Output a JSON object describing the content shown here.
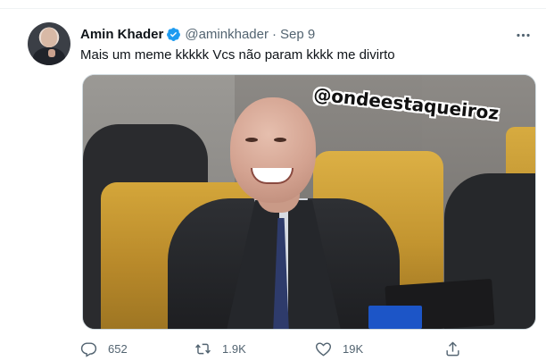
{
  "tweet": {
    "author_name": "Amin Khader",
    "handle": "@aminkhader",
    "separator": "·",
    "date": "Sep 9",
    "text": "Mais um meme kkkkk Vcs não param kkkk me divirto",
    "media": {
      "watermark_text": "@ondeestaqueiroz"
    },
    "actions": {
      "reply_count": "652",
      "retweet_count": "1.9K",
      "like_count": "19K"
    }
  },
  "colors": {
    "verified_badge": "#1d9bf0",
    "secondary_text": "#536471",
    "primary_text": "#0f1419"
  },
  "icons": {
    "verified": "verified-badge-icon",
    "more": "more-horizontal-icon",
    "reply": "reply-icon",
    "retweet": "retweet-icon",
    "like": "heart-icon",
    "share": "share-icon"
  }
}
